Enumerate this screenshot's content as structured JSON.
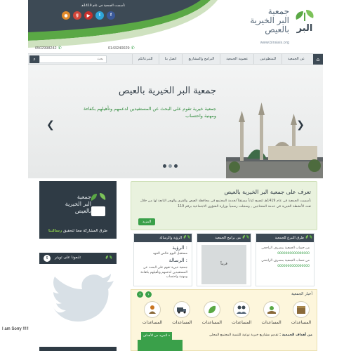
{
  "header": {
    "logo_title": "جمعية\nالبر الخيرية\nبالعيص",
    "logo_mark_text": "البر",
    "logo_url": "www.biralais.org",
    "founded": "تأسست الجمعية في عام 1419هـ",
    "phone_left": "0502998242",
    "phone_right": "0143240029",
    "social": [
      {
        "name": "rss",
        "glyph": "◉",
        "color": "#e08a2b"
      },
      {
        "name": "googleplus",
        "glyph": "g",
        "color": "#d2463a"
      },
      {
        "name": "youtube",
        "glyph": "▶",
        "color": "#c9302c"
      },
      {
        "name": "twitter",
        "glyph": "t",
        "color": "#2ea5d9"
      },
      {
        "name": "facebook",
        "glyph": "f",
        "color": "#3b5998"
      }
    ]
  },
  "nav": {
    "items": [
      "عن الجمعية",
      "للمتطوعين",
      "عضوية الجمعية",
      "البرامج والمشاريع",
      "اتصل بنا",
      "للتبرعاتكم"
    ],
    "search_placeholder": "بحث"
  },
  "slider": {
    "title": "جمعية البر الخيرية بالعيص",
    "subtitle": "جمعية خيرية تقوم على البحث عن المستفيدين لدعمهم وتأهيلهم بكفاءة ومهنية واحتساب",
    "arrow_left": "❮",
    "arrow_right": "❯"
  },
  "cta": {
    "title": "جمعية\nالبر الخيرية\nبالعيص",
    "text_prefix": "طرق المشاركة معنا لتحقيق",
    "text_highlight": "رسالتنا"
  },
  "twitter": {
    "label": "تابعونا على تويتر"
  },
  "about": {
    "title": "تعرف على جمعية البر الخيرية بالعيص",
    "text": "تأسست الجمعية في عام 1419هـ لتصبح كياناً مستقلاً لخدمة المجتمع في محافظة العيص والقرى والهجر التابعة لها من خلال تعدد الأنشطة الخيرية في خدمة المحتاجين , وسجلت رسمياً بوزارة الشؤون الاجتماعية برقم 119",
    "more": "المزيد"
  },
  "boxes": {
    "donate": {
      "title": "طرق التبرع للجمعية",
      "line1": "من حساب الجمعية بمصرف الراجحي",
      "num1": "0000000000000000",
      "line2": "من حساب الجمعية بمصرف الراجحي",
      "num2": "0000000000000000"
    },
    "programs": {
      "title": "من برامج الجمعية",
      "soon": "قريباً"
    },
    "vision": {
      "title": "الرؤية والرسالة",
      "vision_label": "الرؤية :",
      "vision_text": "جمعية خيرية تقوم على البحث عن المستفيدين لدعمهم وتأهيلهم بكفاءة ومهنية واحتساب",
      "mission_label": "الرسالة :",
      "mission_text": "مستقبل اليوم خالص الجهد"
    }
  },
  "news": {
    "title": "أخبار الجمعية",
    "items": [
      {
        "label": "المساعدات",
        "icon": "box"
      },
      {
        "label": "المساعدات",
        "icon": "hands"
      },
      {
        "label": "المساعدات",
        "icon": "people"
      },
      {
        "label": "المساعدات",
        "icon": "leaf"
      },
      {
        "label": "المساعدات",
        "icon": "truck"
      },
      {
        "label": "المساعدات",
        "icon": "family"
      }
    ],
    "goals_label": "من أهداف الجمعية :",
    "goals_text": "تقديم مشاريع خيرية نوعية للتنمية المجتمع المحلي",
    "goals_more": "المزيد من الأهداف »"
  },
  "footer_note": "I am Sorry !!!!!"
}
